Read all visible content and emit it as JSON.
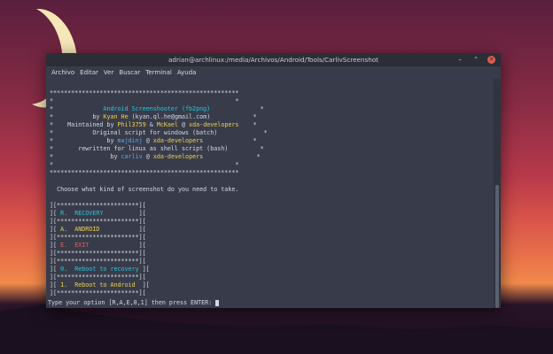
{
  "window": {
    "title": "adrian@archlinux:/media/Archivos/Android/Tools/CarlivScreenshot"
  },
  "window_controls": {
    "minimize": "–",
    "maximize": "⌃",
    "close": "✕"
  },
  "menu": [
    "Archivo",
    "Editar",
    "Ver",
    "Buscar",
    "Terminal",
    "Ayuda"
  ],
  "terminal": {
    "border": "*****************************************************",
    "edge": "*                                                   *",
    "header": {
      "title": "Android Screenshooter (fb2png)",
      "by": "by",
      "author": "Kyan He",
      "author_email": "(kyan.ql.he@gmail.com)",
      "maintained_by": "Maintained by",
      "maintainer1": "Phil3759",
      "amp": "&",
      "maintainer2": "McKael",
      "at": "@",
      "community": "xda-developers",
      "original_script": "Original script for windows (batch)",
      "author2": "majdinj",
      "rewritten": "rewritten for linux as shell script (bash)",
      "author3": "carliv"
    },
    "prompt_question": "Choose what kind of screenshot do you need to take.",
    "options": [
      {
        "label": "R.  RECOVERY",
        "color": "cyan"
      },
      {
        "label": "A.  ANDROID",
        "color": "yellow"
      },
      {
        "label": "E.  EXIT",
        "color": "red"
      },
      {
        "label": "0.  Reboot to recovery",
        "color": "cyan"
      },
      {
        "label": "1.  Reboot to Android",
        "color": "yellow"
      }
    ],
    "menu_border": "][***********************][",
    "option_left": "][",
    "option_right": "][",
    "input_prompt": "Type your option [R,A,E,0,1] then press ENTER: "
  },
  "colors": {
    "cyan": "#2bc4d6",
    "yellow": "#f2d24a",
    "red": "#e35d4f",
    "blue": "#5fa6e6"
  }
}
